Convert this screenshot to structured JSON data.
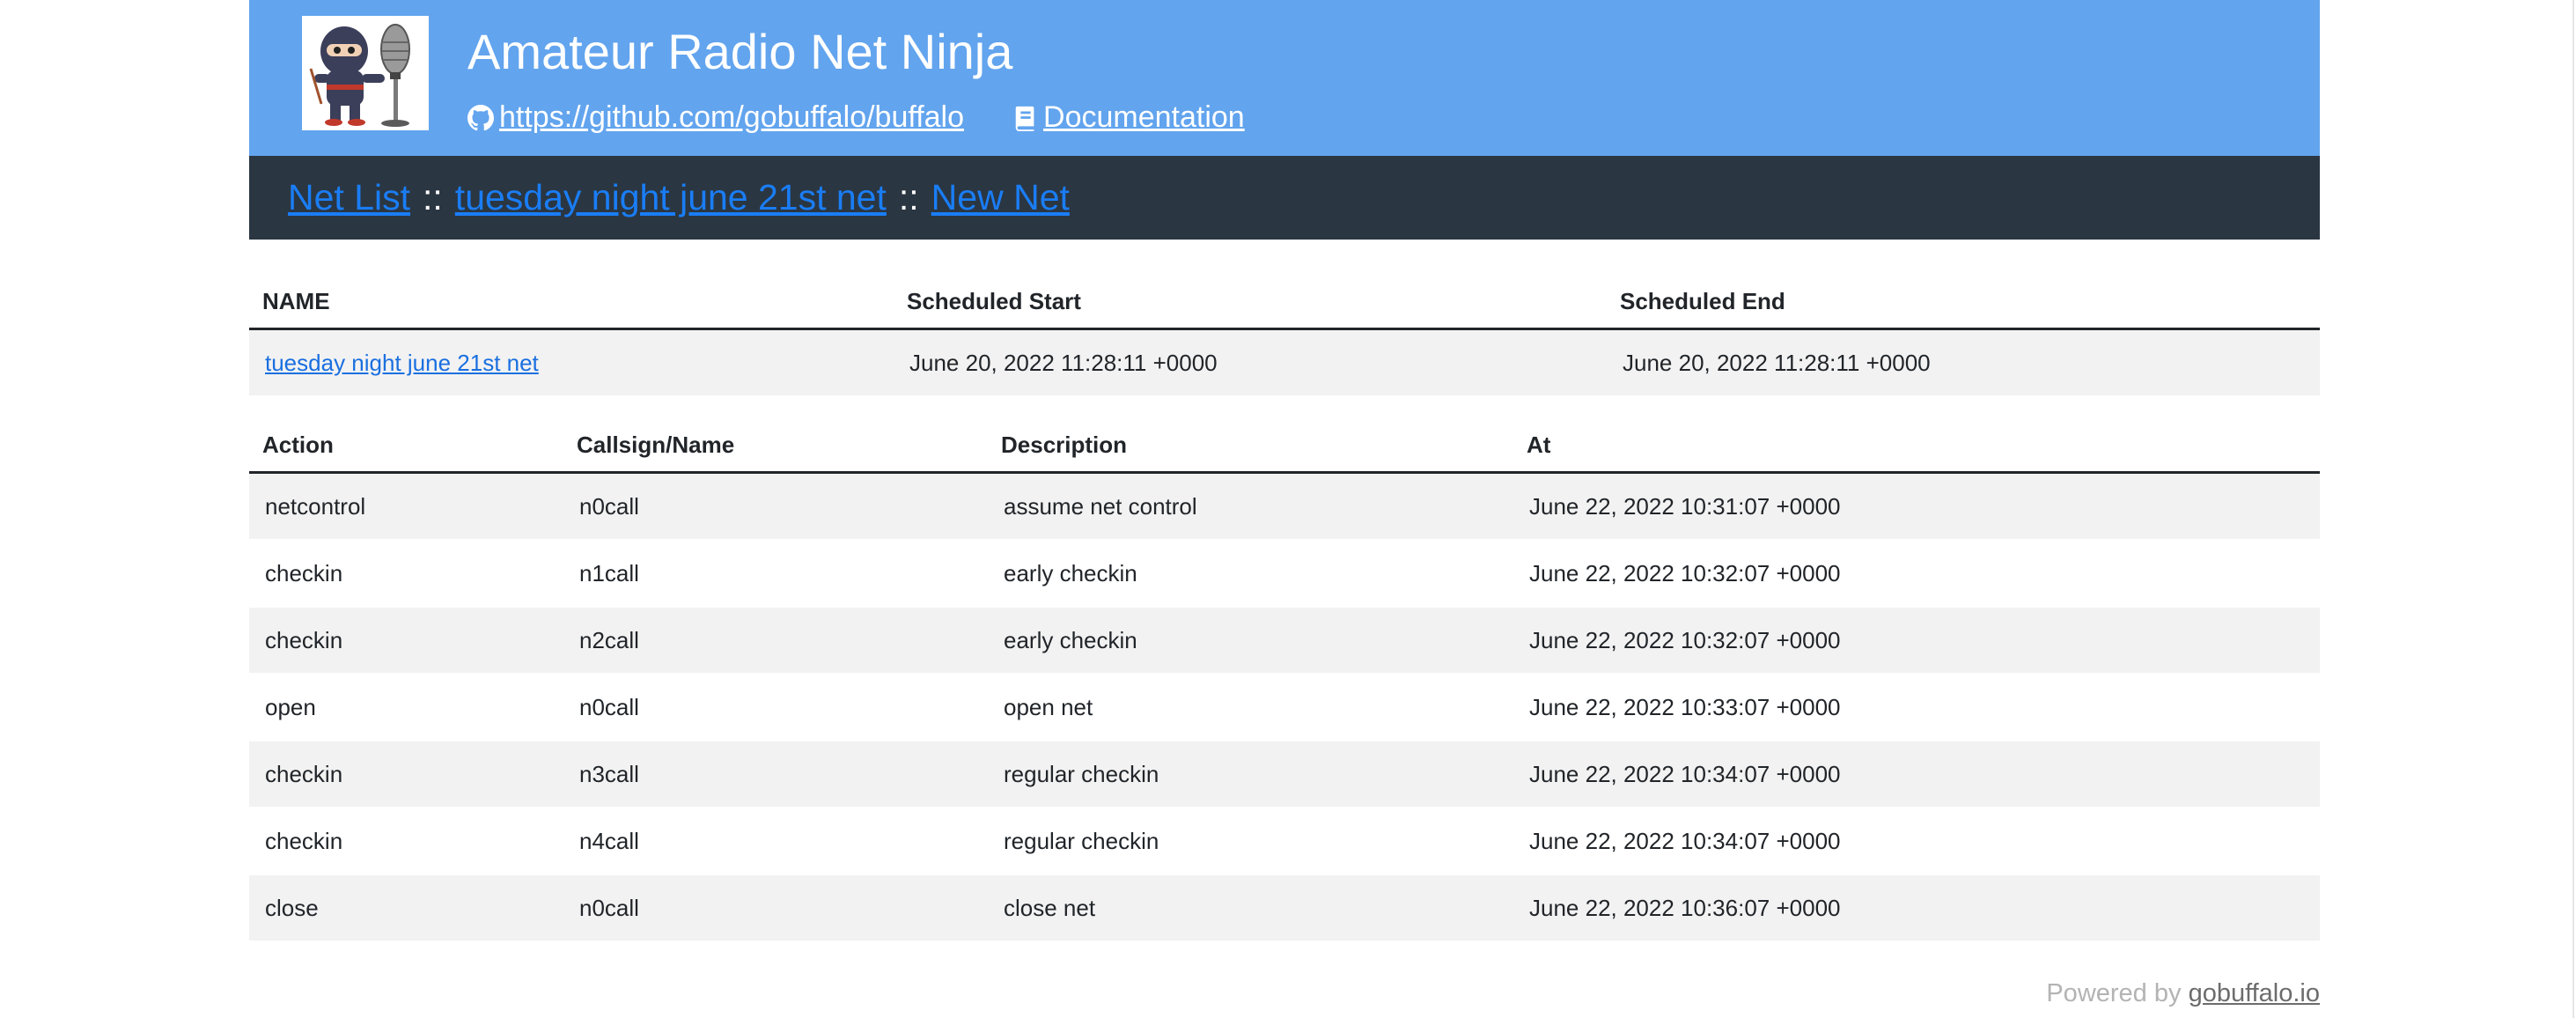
{
  "header": {
    "title": "Amateur Radio Net Ninja",
    "github_link": "https://github.com/gobuffalo/buffalo",
    "docs_link": "Documentation",
    "bg_color": "#62a4ee"
  },
  "nav": {
    "items": [
      "Net List",
      "tuesday night june 21st net",
      "New Net"
    ],
    "separator": "::",
    "link_color": "#1a7df5",
    "bg_color": "#2a3642"
  },
  "net_table": {
    "headers": [
      "NAME",
      "Scheduled Start",
      "Scheduled End"
    ],
    "row": {
      "name": "tuesday night june 21st net",
      "start": "June 20, 2022 11:28:11 +0000",
      "end": "June 20, 2022 11:28:11 +0000"
    }
  },
  "events_table": {
    "headers": [
      "Action",
      "Callsign/Name",
      "Description",
      "At"
    ],
    "rows": [
      [
        "netcontrol",
        "n0call",
        "assume net control",
        "June 22, 2022 10:31:07 +0000"
      ],
      [
        "checkin",
        "n1call",
        "early checkin",
        "June 22, 2022 10:32:07 +0000"
      ],
      [
        "checkin",
        "n2call",
        "early checkin",
        "June 22, 2022 10:32:07 +0000"
      ],
      [
        "open",
        "n0call",
        "open net",
        "June 22, 2022 10:33:07 +0000"
      ],
      [
        "checkin",
        "n3call",
        "regular checkin",
        "June 22, 2022 10:34:07 +0000"
      ],
      [
        "checkin",
        "n4call",
        "regular checkin",
        "June 22, 2022 10:34:07 +0000"
      ],
      [
        "close",
        "n0call",
        "close net",
        "June 22, 2022 10:36:07 +0000"
      ]
    ]
  },
  "footer": {
    "prefix": "Powered by",
    "link": "gobuffalo.io"
  },
  "icons": {
    "github": "github-icon",
    "docs": "book-icon",
    "logo": "ninja-microphone-logo"
  }
}
